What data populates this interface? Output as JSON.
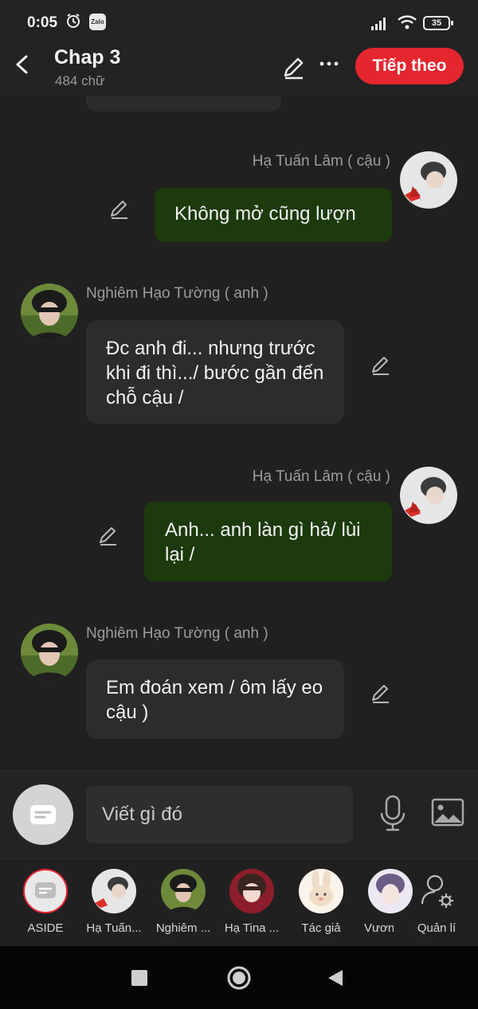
{
  "status_bar": {
    "time": "0:05",
    "zalo_label": "Zalo",
    "battery": "35"
  },
  "header": {
    "title": "Chap 3",
    "subtitle": "484 chữ",
    "next_button": "Tiếp theo"
  },
  "messages": [
    {
      "sender": "Hạ Tuấn Lâm ( cậu )",
      "side": "right",
      "text": "Không mở cũng lượn"
    },
    {
      "sender": "Nghiêm Hạo Tường ( anh )",
      "side": "left",
      "text": "Đc anh đi... nhưng trước khi đi thì.../ bước gần đến chỗ cậu /"
    },
    {
      "sender": "Hạ Tuấn Lâm ( cậu )",
      "side": "right",
      "text": "Anh... anh làn gì hả/ lùi lại /"
    },
    {
      "sender": "Nghiêm Hạo Tường ( anh )",
      "side": "left",
      "text": "Em đoán xem / ôm lấy eo cậu )"
    }
  ],
  "composer": {
    "placeholder": "Viết gì đó"
  },
  "characters": [
    {
      "label": "ASIDE"
    },
    {
      "label": "Hạ Tuấn..."
    },
    {
      "label": "Nghiêm ..."
    },
    {
      "label": "Hạ Tina ..."
    },
    {
      "label": "Tác giả"
    },
    {
      "label": "Vương"
    },
    {
      "label": "Quản lí"
    }
  ],
  "colors": {
    "accent": "#e4262f",
    "my_bubble": "#1c3a0c",
    "other_bubble": "#2c2c2c",
    "background": "#202020"
  }
}
